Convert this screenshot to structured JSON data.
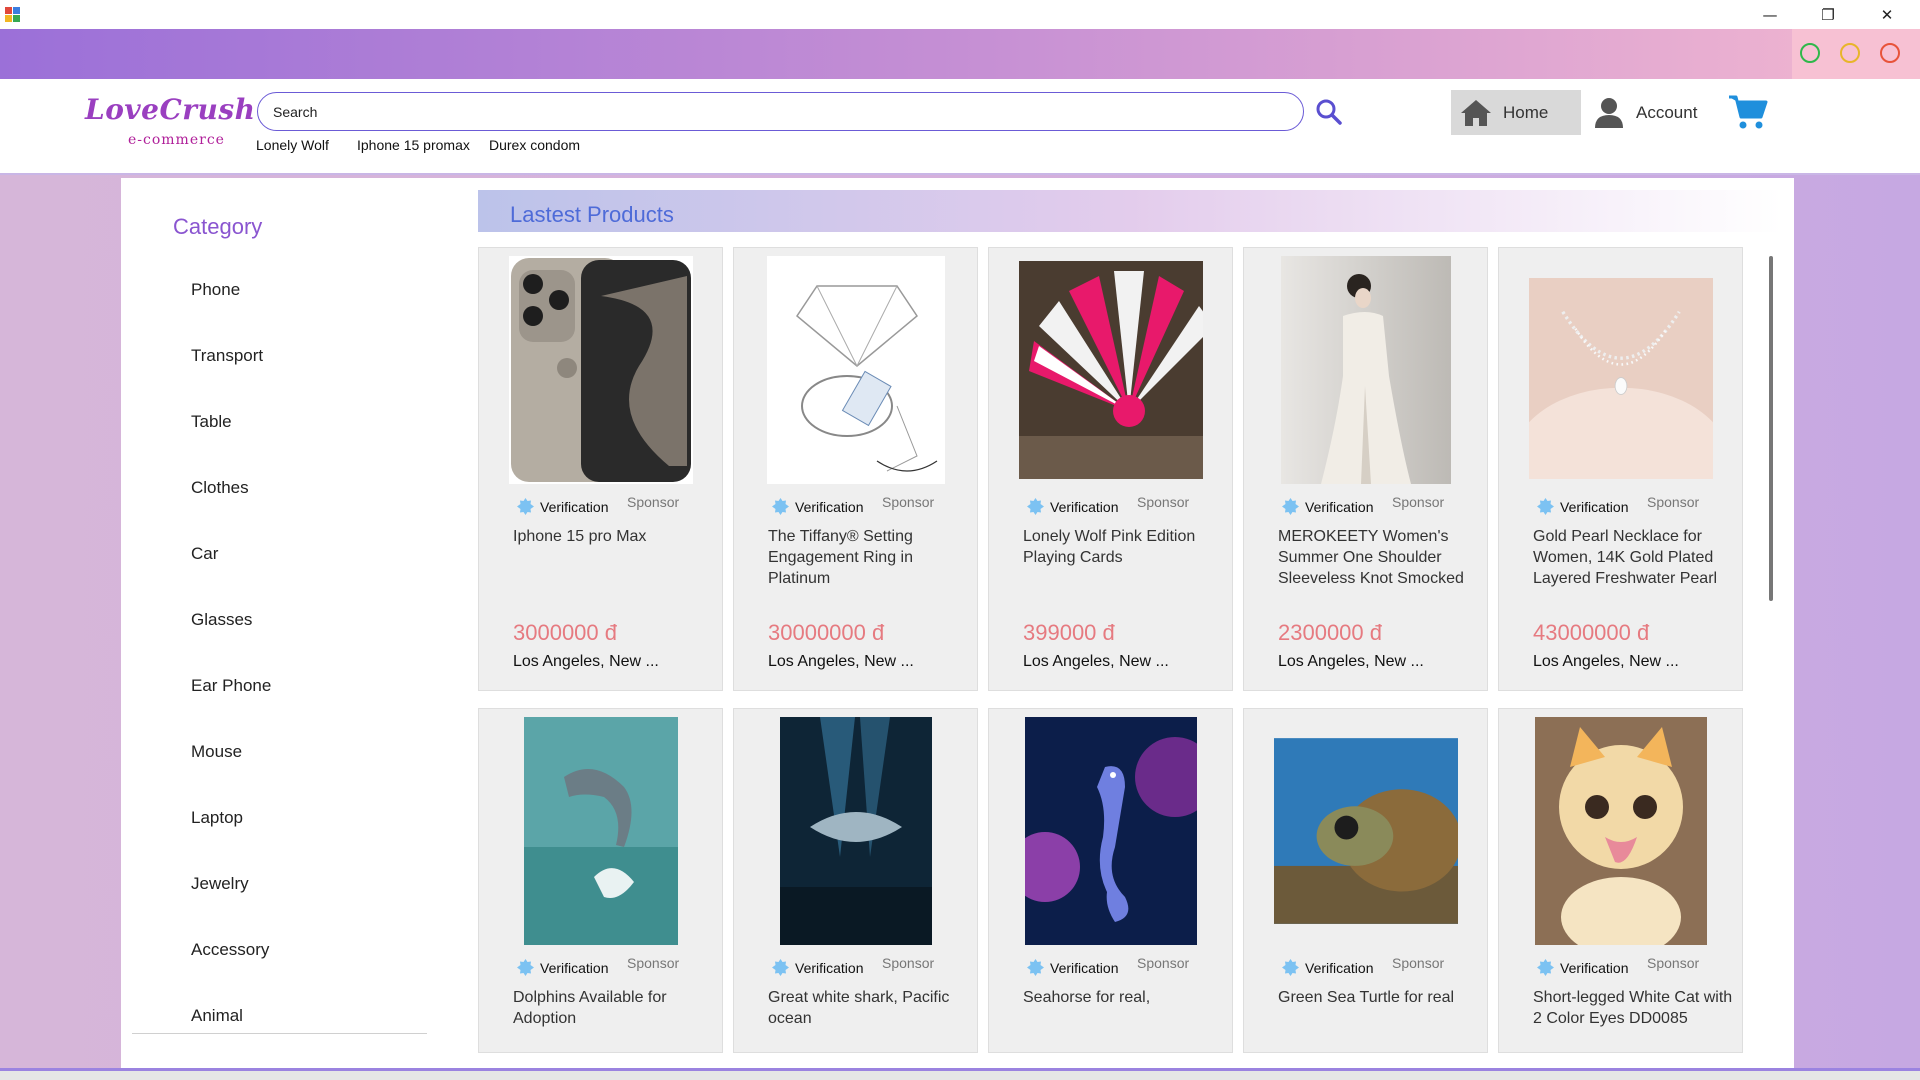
{
  "window": {
    "minimize_glyph": "—",
    "restore_glyph": "❐",
    "close_glyph": "✕"
  },
  "header": {
    "logo_main": "LoveCrush",
    "logo_sub": "e-commerce",
    "search_placeholder": "Search",
    "suggestions": [
      "Lonely Wolf",
      "Iphone 15 promax",
      "Durex condom"
    ],
    "nav_home": "Home",
    "nav_account": "Account",
    "icons": [
      "search-icon",
      "home-icon",
      "user-icon",
      "cart-icon"
    ]
  },
  "colors": {
    "brand_purple": "#9b70d8",
    "price": "#e67a80",
    "section_title": "#4e6bd8",
    "window_dot_green": "#2fb84a",
    "window_dot_yellow": "#e8b52a",
    "window_dot_red": "#e8533a"
  },
  "category": {
    "title": "Category",
    "items": [
      "Phone",
      "Transport",
      "Table",
      "Clothes",
      "Car",
      "Glasses",
      "Ear Phone",
      "Mouse",
      "Laptop",
      "Jewelry",
      "Accessory",
      "Animal"
    ]
  },
  "products": {
    "section_title": "Lastest Products",
    "items": [
      {
        "title": "Iphone 15 pro Max",
        "verification": "Verification",
        "sponsor": "Sponsor",
        "price": "3000000 đ",
        "location": "Los Angeles, New ...",
        "image": "phone"
      },
      {
        "title": "The Tiffany® Setting Engagement Ring in Platinum",
        "verification": "Verification",
        "sponsor": "Sponsor",
        "price": "30000000 đ",
        "location": "Los Angeles, New ...",
        "image": "ring-sketch"
      },
      {
        "title": "Lonely Wolf Pink Edition Playing Cards",
        "verification": "Verification",
        "sponsor": "Sponsor",
        "price": "399000 đ",
        "location": "Los Angeles, New ...",
        "image": "cards"
      },
      {
        "title": "MEROKEETY Women's Summer One Shoulder Sleeveless Knot Smocked",
        "verification": "Verification",
        "sponsor": "Sponsor",
        "price": "2300000 đ",
        "location": "Los Angeles, New ...",
        "image": "dress"
      },
      {
        "title": "Gold Pearl Necklace for Women, 14K Gold Plated Layered Freshwater Pearl",
        "verification": "Verification",
        "sponsor": "Sponsor",
        "price": "43000000 đ",
        "location": "Los Angeles, New ...",
        "image": "necklace"
      },
      {
        "title": "Dolphins Available for Adoption",
        "verification": "Verification",
        "sponsor": "Sponsor",
        "price": "",
        "location": "",
        "image": "dolphin"
      },
      {
        "title": "Great white shark, Pacific ocean",
        "verification": "Verification",
        "sponsor": "Sponsor",
        "price": "",
        "location": "",
        "image": "shark"
      },
      {
        "title": "Seahorse for real,",
        "verification": "Verification",
        "sponsor": "Sponsor",
        "price": "",
        "location": "",
        "image": "seahorse"
      },
      {
        "title": "Green Sea Turtle for real",
        "verification": "Verification",
        "sponsor": "Sponsor",
        "price": "",
        "location": "",
        "image": "turtle"
      },
      {
        "title": "Short-legged White Cat with 2 Color Eyes DD0085",
        "verification": "Verification",
        "sponsor": "Sponsor",
        "price": "",
        "location": "",
        "image": "cat"
      }
    ]
  }
}
